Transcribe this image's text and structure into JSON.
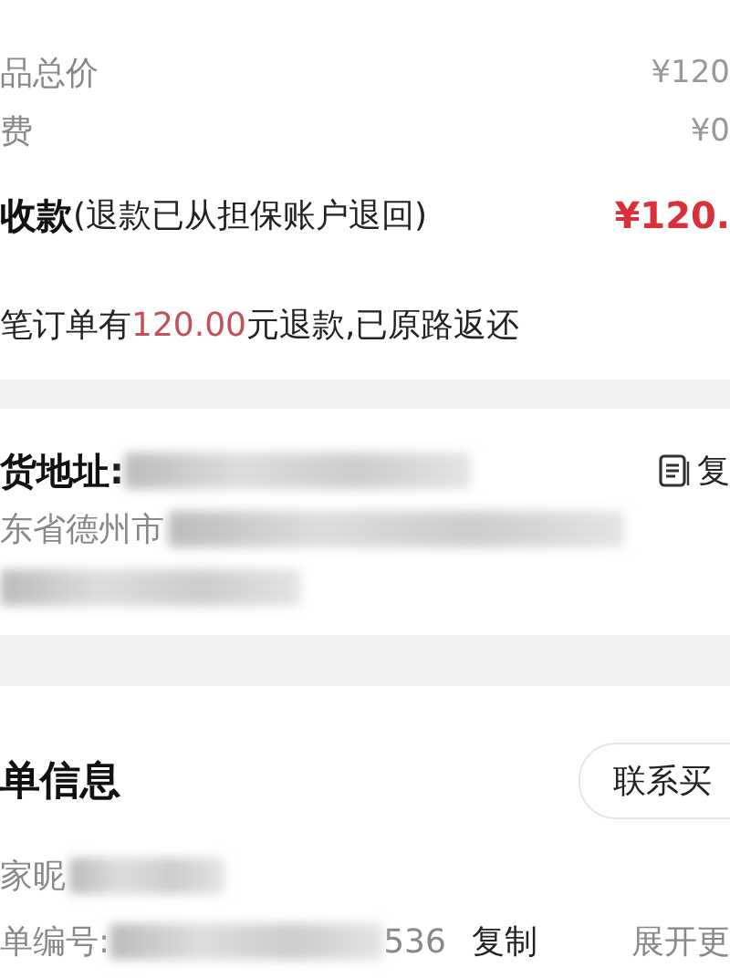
{
  "price_rows": [
    {
      "label": "品总价",
      "value": "¥120"
    },
    {
      "label": "费",
      "value": "¥0"
    }
  ],
  "refund_row": {
    "label_bold": "收款",
    "label_note": "(退款已从担保账户退回)",
    "value": "¥120."
  },
  "refund_notice": {
    "prefix": "笔订单有",
    "amount": "120.00",
    "suffix": "元退款,已原路返还"
  },
  "address": {
    "label": "货地址:",
    "copy": "复",
    "line_1": "东省德州市"
  },
  "order_info": {
    "title": "单信息",
    "contact_button": "联系买",
    "nickname_label": "家昵",
    "number_label": "单编号:",
    "number_tail": "536",
    "copy": "复制",
    "expand": "展开更"
  }
}
